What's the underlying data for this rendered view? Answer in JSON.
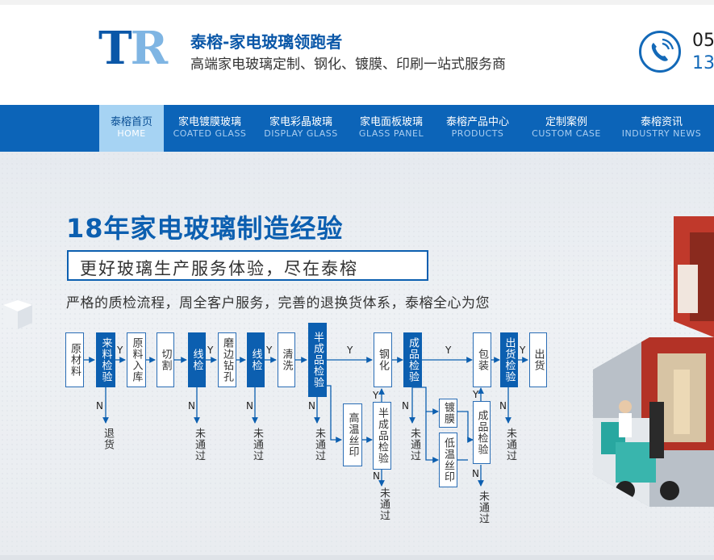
{
  "header": {
    "logo_t": "T",
    "logo_r": "R",
    "title": "泰榕-家电玻璃领跑者",
    "subtitle": "高端家电玻璃定制、钢化、镀膜、印刷一站式服务商",
    "phone_icon": "phone-icon",
    "phone_line1": "05",
    "phone_line2": "13"
  },
  "nav": {
    "items": [
      {
        "zh": "泰榕首页",
        "en": "HOME"
      },
      {
        "zh": "家电镀膜玻璃",
        "en": "COATED GLASS"
      },
      {
        "zh": "家电彩晶玻璃",
        "en": "DISPLAY GLASS"
      },
      {
        "zh": "家电面板玻璃",
        "en": "GLASS PANEL"
      },
      {
        "zh": "泰榕产品中心",
        "en": "PRODUCTS"
      },
      {
        "zh": "定制案例",
        "en": "CUSTOM CASE"
      },
      {
        "zh": "泰榕资讯",
        "en": "INDUSTRY NEWS"
      }
    ],
    "active_index": 0
  },
  "banner": {
    "headline_num": "18",
    "headline_rest": "年家电玻璃制造经验",
    "slogan": "更好玻璃生产服务体验，尽在泰榕",
    "desc": "严格的质检流程，周全客户服务，完善的退换货体系，泰榕全心为您"
  },
  "flow": {
    "steps": {
      "raw": "原材料",
      "incoming": "来料检验",
      "storage": "原料入库",
      "cut": "切割",
      "line1": "线检",
      "edge": "磨边钻孔",
      "line2": "线检",
      "wash": "清洗",
      "semi": "半成品检验",
      "temper": "钢化",
      "silk": "高温丝印",
      "semi2": "半成品检验",
      "finished": "成品检验",
      "coat": "镀膜",
      "lowsilk": "低温丝印",
      "pack": "包装",
      "finished2": "成品检验",
      "outgoing": "出货检验",
      "ship": "出货"
    },
    "yes": "Y",
    "no": "N",
    "return": "退货",
    "fail": "未通过"
  },
  "colors": {
    "brand": "#0c5fb0",
    "nav": "#0c64b8",
    "nav_active": "#a6d3f3"
  }
}
